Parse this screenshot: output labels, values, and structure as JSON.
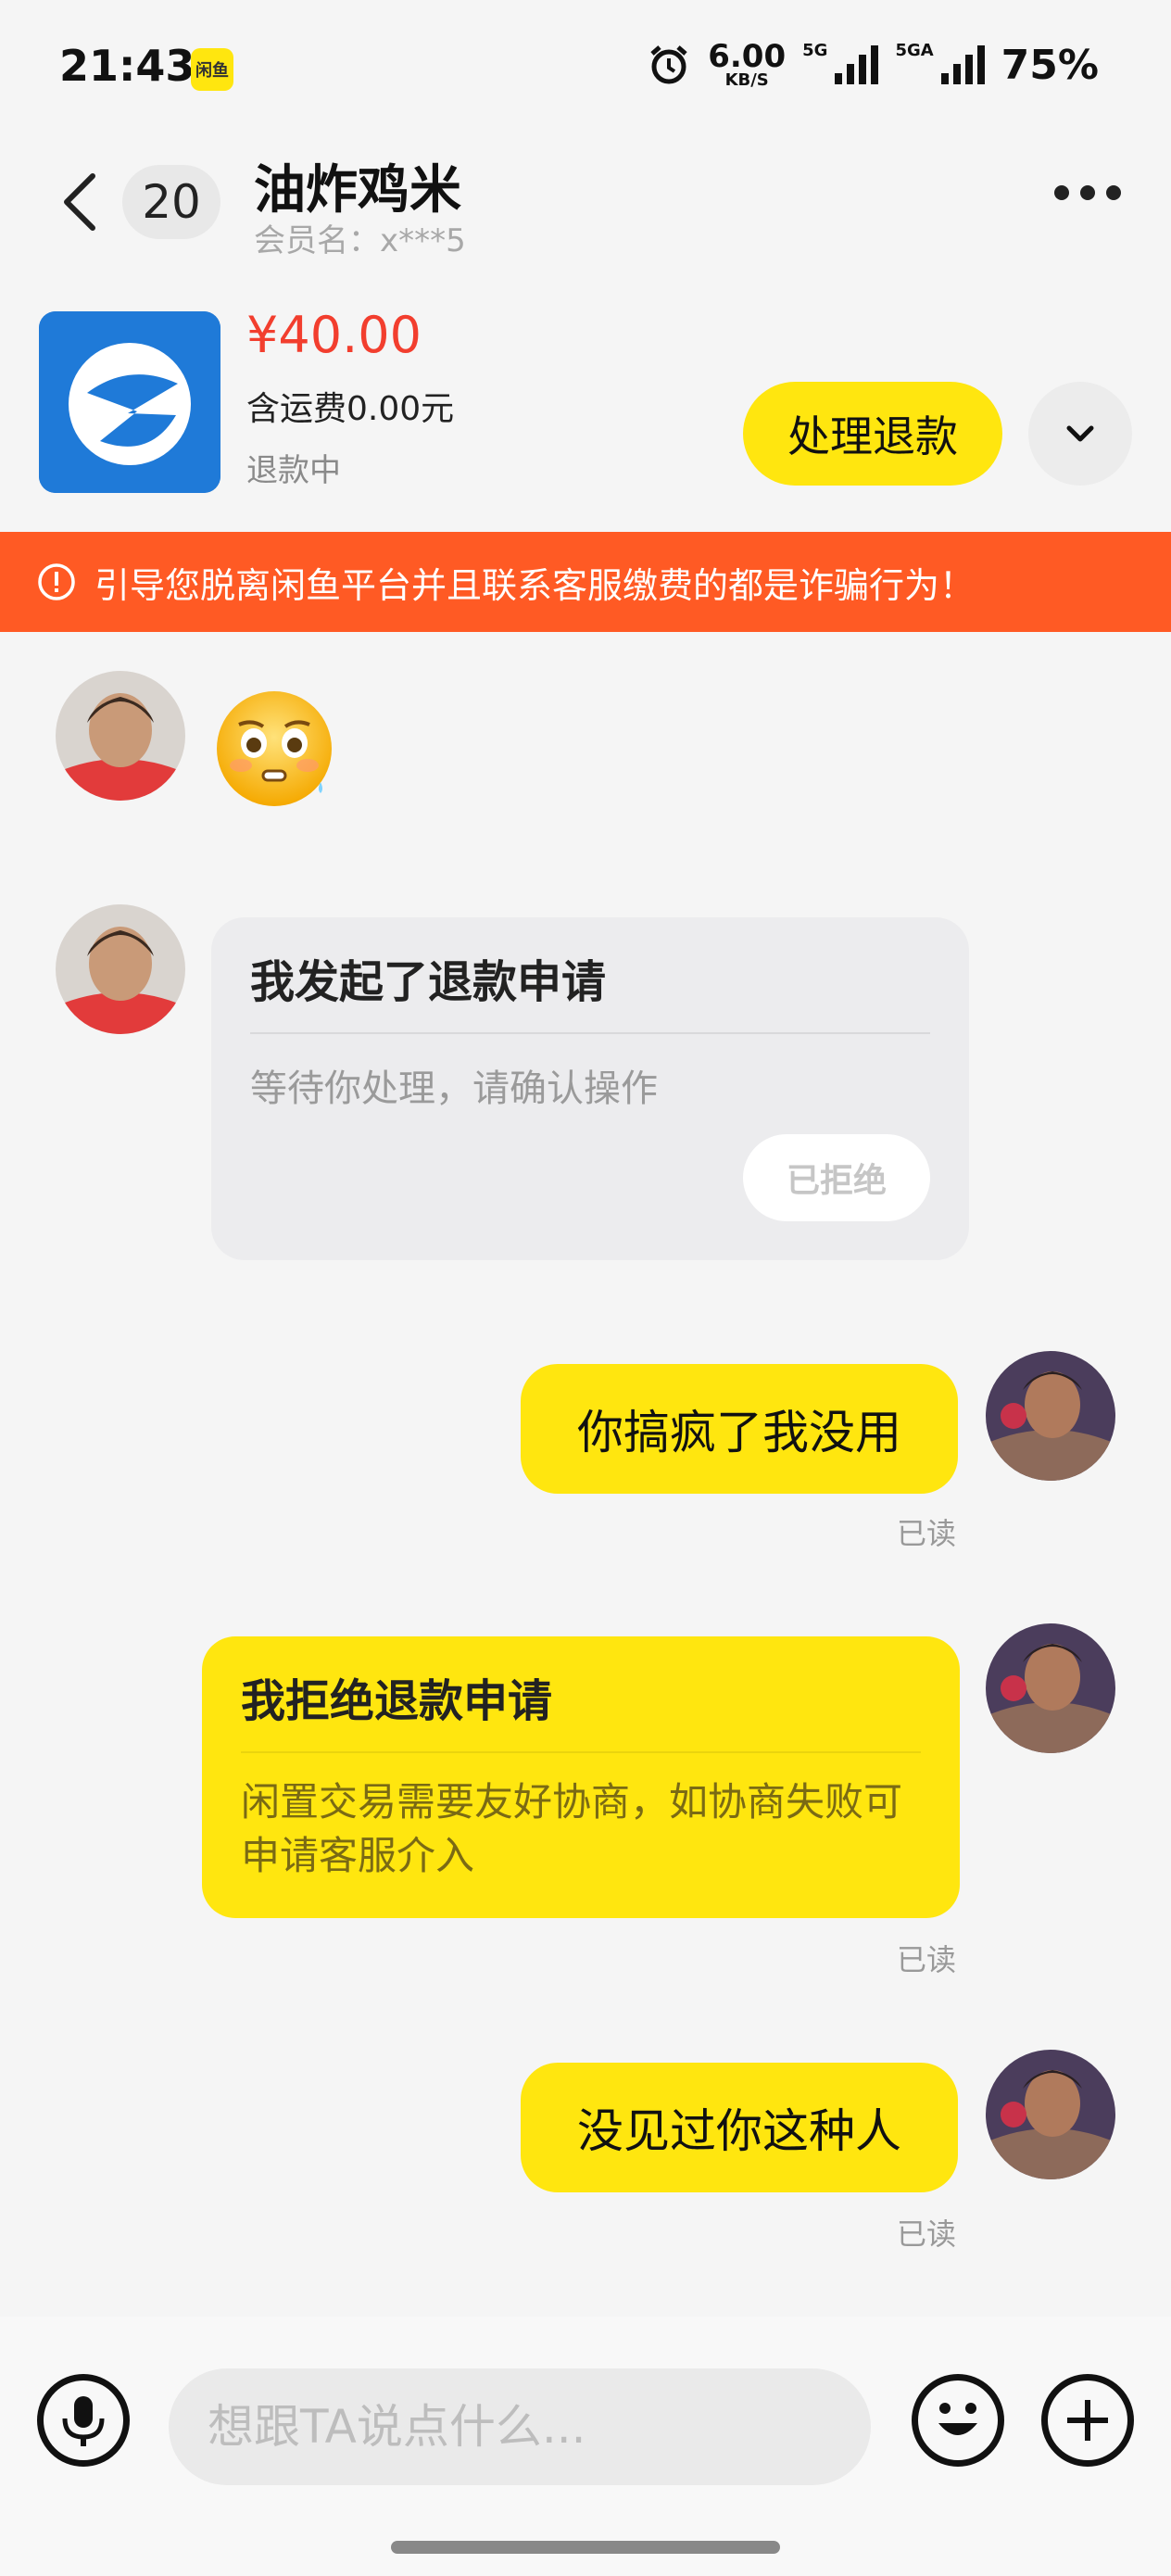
{
  "status_bar": {
    "time": "21:43",
    "app_icon_text": "闲鱼",
    "net_speed_value": "6.00",
    "net_speed_unit": "KB/S",
    "net1_label": "5G",
    "net2_label": "5GA",
    "battery": "75%"
  },
  "header": {
    "unread_count": "20",
    "title": "油炸鸡米",
    "member_name": "会员名：x***5"
  },
  "product": {
    "price": "¥40.00",
    "shipping": "含运费0.00元",
    "status": "退款中",
    "refund_button": "处理退款"
  },
  "warning": {
    "text": "引导您脱离闲鱼平台并且联系客服缴费的都是诈骗行为！"
  },
  "messages": {
    "emoji_message": "emoji-flushed-face",
    "refund_card": {
      "title": "我发起了退款申请",
      "body": "等待你处理，请确认操作",
      "status": "已拒绝"
    },
    "msg1": {
      "text": "你搞疯了我没用",
      "read": "已读"
    },
    "reject_card": {
      "title": "我拒绝退款申请",
      "body": "闲置交易需要友好协商，如协商失败可申请客服介入",
      "read": "已读"
    },
    "msg2": {
      "text": "没见过你这种人",
      "read": "已读"
    }
  },
  "input": {
    "placeholder": "想跟TA说点什么..."
  },
  "colors": {
    "accent_yellow": "#ffe60f",
    "warning_orange": "#ff5a24",
    "price_red": "#f23e2e"
  }
}
